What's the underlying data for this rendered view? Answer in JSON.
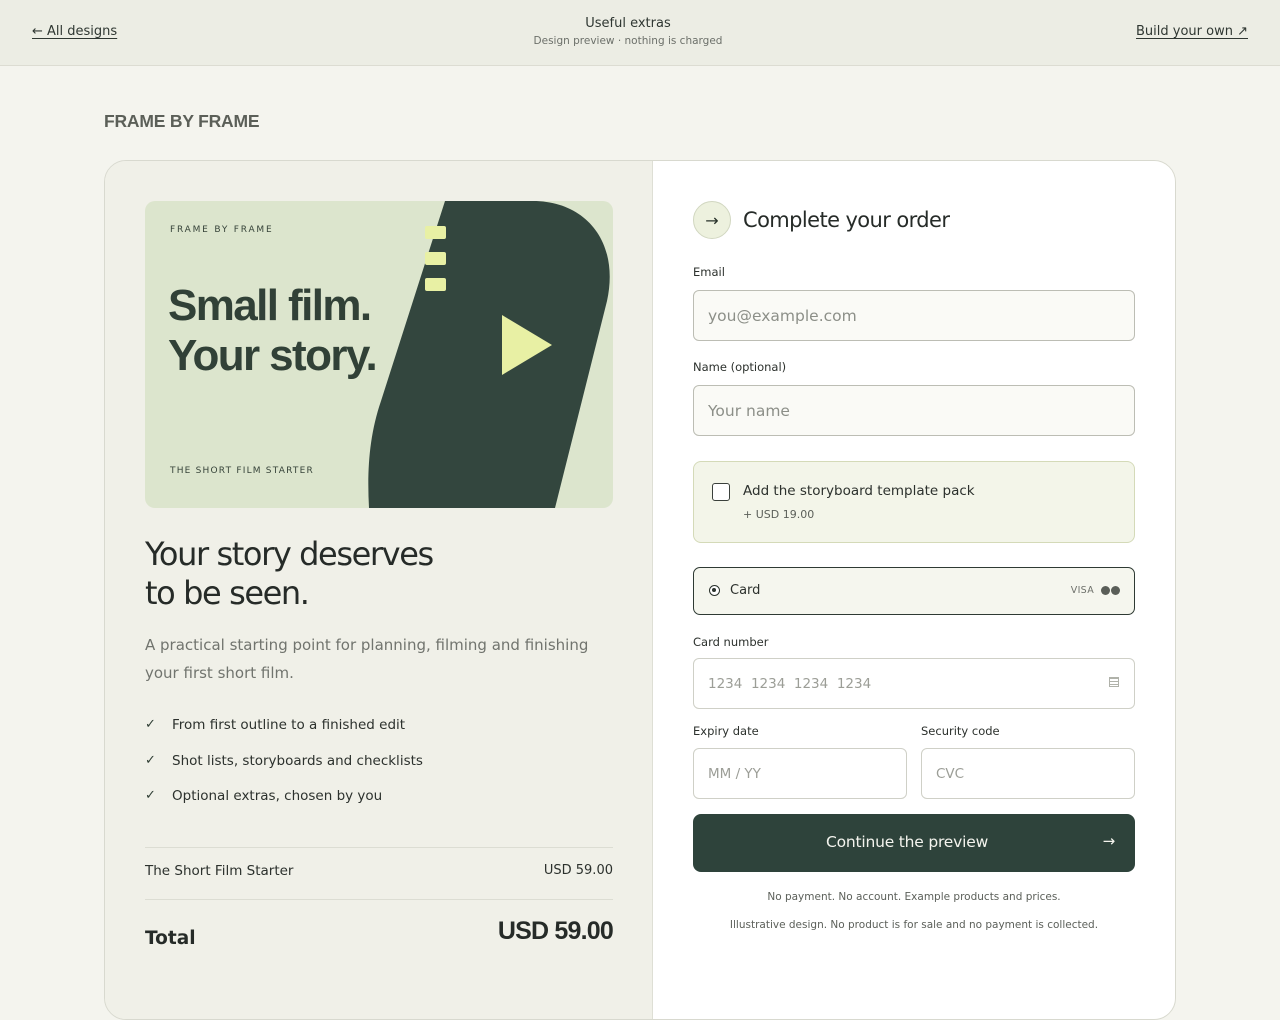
{
  "topbar": {
    "back_label": "← All designs",
    "title": "Useful extras",
    "subtitle": "Design preview · nothing is charged",
    "build_label": "Build your own ↗"
  },
  "brand": "FRAME BY FRAME",
  "hero": {
    "kicker": "FRAME BY FRAME",
    "headline_line1": "Small film.",
    "headline_line2": "Your story.",
    "footer": "THE SHORT FILM STARTER"
  },
  "product": {
    "headline_line1": "Your story deserves",
    "headline_line2": "to be seen.",
    "description": "A practical starting point for planning, filming and finishing your first short film.",
    "features": [
      "From first outline to a finished edit",
      "Shot lists, storyboards and checklists",
      "Optional extras, chosen by you"
    ]
  },
  "summary": {
    "item_name": "The Short Film Starter",
    "item_price": "USD 59.00",
    "total_label": "Total",
    "total_value": "USD 59.00"
  },
  "form": {
    "title": "Complete your order",
    "email_label": "Email",
    "email_placeholder": "you@example.com",
    "name_label": "Name (optional)",
    "name_placeholder": "Your name",
    "addon_title": "Add the storyboard template pack",
    "addon_price": "+ USD 19.00",
    "addon_checked": false,
    "payment_method": "Card",
    "payment_brand": "VISA",
    "card_number_label": "Card number",
    "card_number_placeholder": "1234  1234  1234  1234",
    "expiry_label": "Expiry date",
    "expiry_placeholder": "MM / YY",
    "cvc_label": "Security code",
    "cvc_placeholder": "CVC",
    "submit_label": "Continue the preview",
    "note1": "No payment. No account. Example products and prices.",
    "note2": "Illustrative design. No product is for sale and no payment is collected."
  },
  "colors": {
    "accent": "#2e433b",
    "hero_bg": "#dce5cd",
    "highlight": "#e8f0a4"
  }
}
